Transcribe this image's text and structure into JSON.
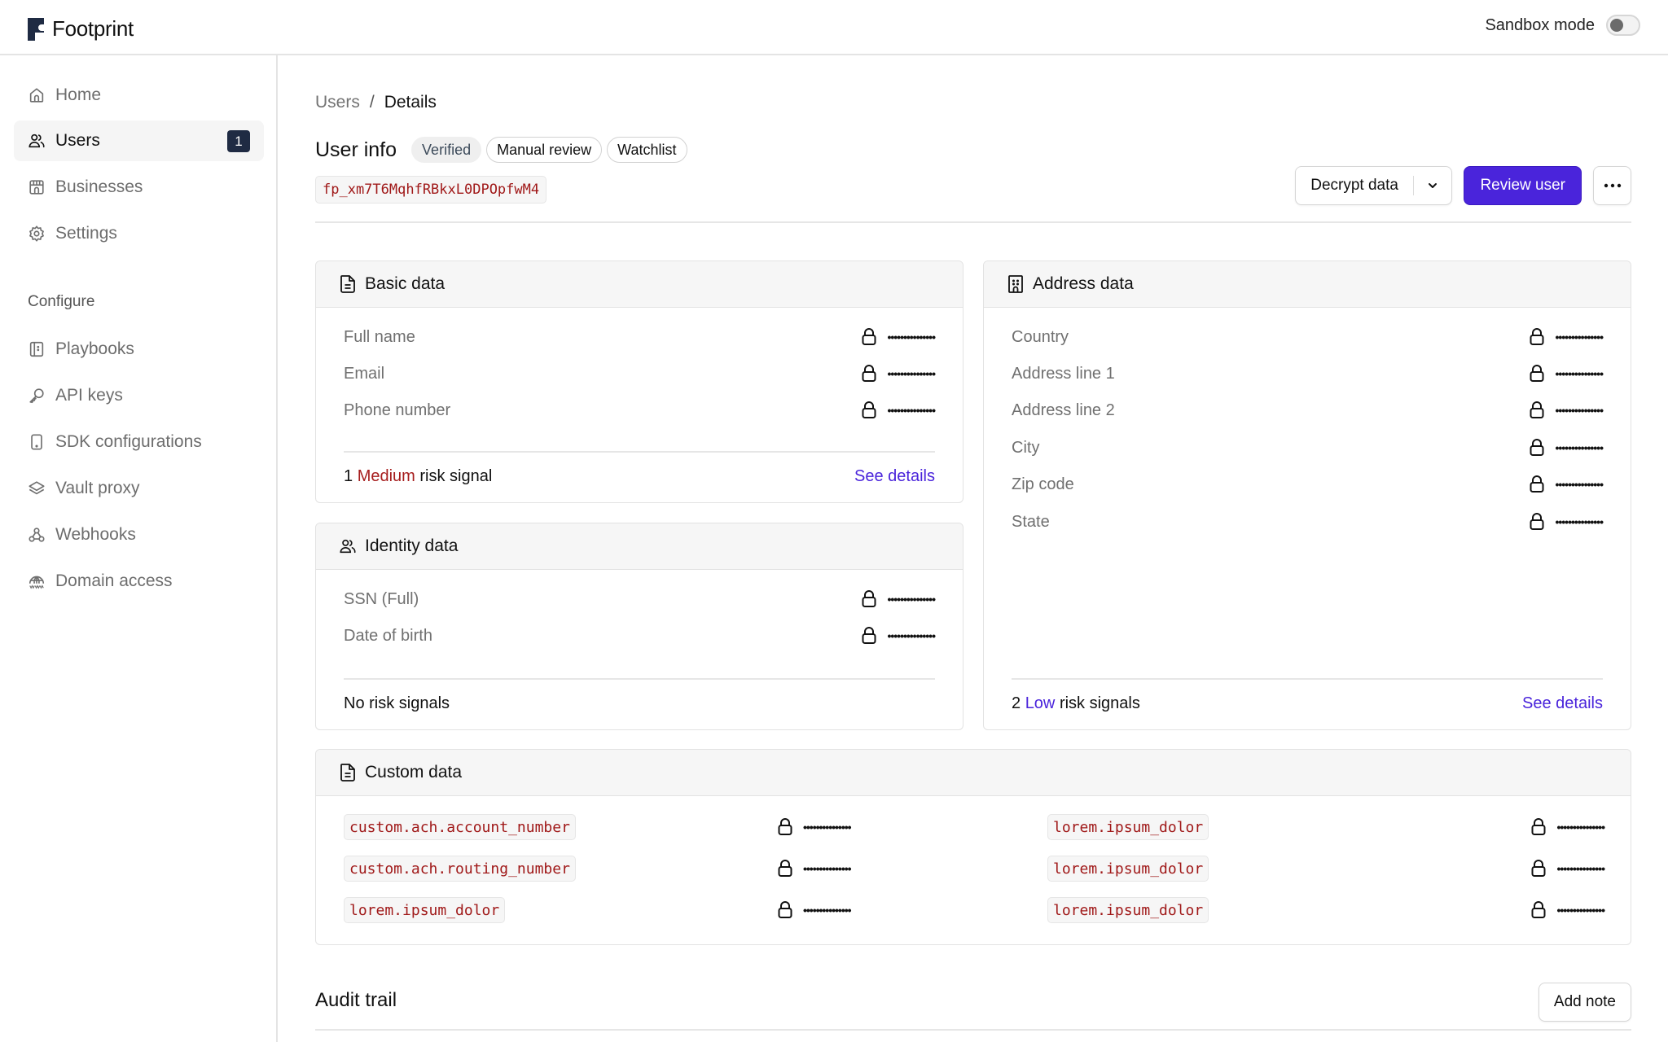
{
  "app": {
    "name": "Footprint",
    "sandbox_label": "Sandbox mode",
    "sandbox_enabled": false
  },
  "sidebar": {
    "primary": [
      {
        "label": "Home",
        "icon": "home-icon"
      },
      {
        "label": "Users",
        "icon": "users-icon",
        "badge": "1",
        "active": true
      },
      {
        "label": "Businesses",
        "icon": "store-icon"
      },
      {
        "label": "Settings",
        "icon": "gear-icon"
      }
    ],
    "section_label": "Configure",
    "configure": [
      {
        "label": "Playbooks",
        "icon": "book-icon"
      },
      {
        "label": "API keys",
        "icon": "key-icon"
      },
      {
        "label": "SDK configurations",
        "icon": "device-icon"
      },
      {
        "label": "Vault proxy",
        "icon": "layers-icon"
      },
      {
        "label": "Webhooks",
        "icon": "webhook-icon"
      },
      {
        "label": "Domain access",
        "icon": "globe-www-icon"
      }
    ]
  },
  "breadcrumb": {
    "parent": "Users",
    "separator": "/",
    "current": "Details"
  },
  "header": {
    "title": "User info",
    "tags": [
      "Verified",
      "Manual review",
      "Watchlist"
    ],
    "user_id": "fp_xm7T6MqhfRBkxL0DPOpfwM4",
    "decrypt_label": "Decrypt data",
    "review_label": "Review user",
    "more_icon": "ellipsis-icon"
  },
  "masked_value": "•••••••••••••••",
  "basic_data": {
    "title": "Basic data",
    "fields": [
      "Full name",
      "Email",
      "Phone number"
    ],
    "risk": {
      "count": "1",
      "level": "Medium",
      "suffix": "risk signal",
      "link": "See details"
    }
  },
  "identity_data": {
    "title": "Identity data",
    "fields": [
      "SSN (Full)",
      "Date of birth"
    ],
    "risk": {
      "text": "No risk signals"
    }
  },
  "address_data": {
    "title": "Address data",
    "fields": [
      "Country",
      "Address line 1",
      "Address line 2",
      "City",
      "Zip code",
      "State"
    ],
    "risk": {
      "count": "2",
      "level": "Low",
      "suffix": "risk signals",
      "link": "See details"
    }
  },
  "custom_data": {
    "title": "Custom data",
    "left": [
      "custom.ach.account_number",
      "custom.ach.routing_number",
      "lorem.ipsum_dolor"
    ],
    "right": [
      "lorem.ipsum_dolor",
      "lorem.ipsum_dolor",
      "lorem.ipsum_dolor"
    ]
  },
  "audit": {
    "title": "Audit trail",
    "add_note_label": "Add note"
  },
  "colors": {
    "accent": "#4a24db",
    "risk_medium": "#a61d1d",
    "code_text": "#a01919",
    "badge_bg": "#1f2b43"
  }
}
